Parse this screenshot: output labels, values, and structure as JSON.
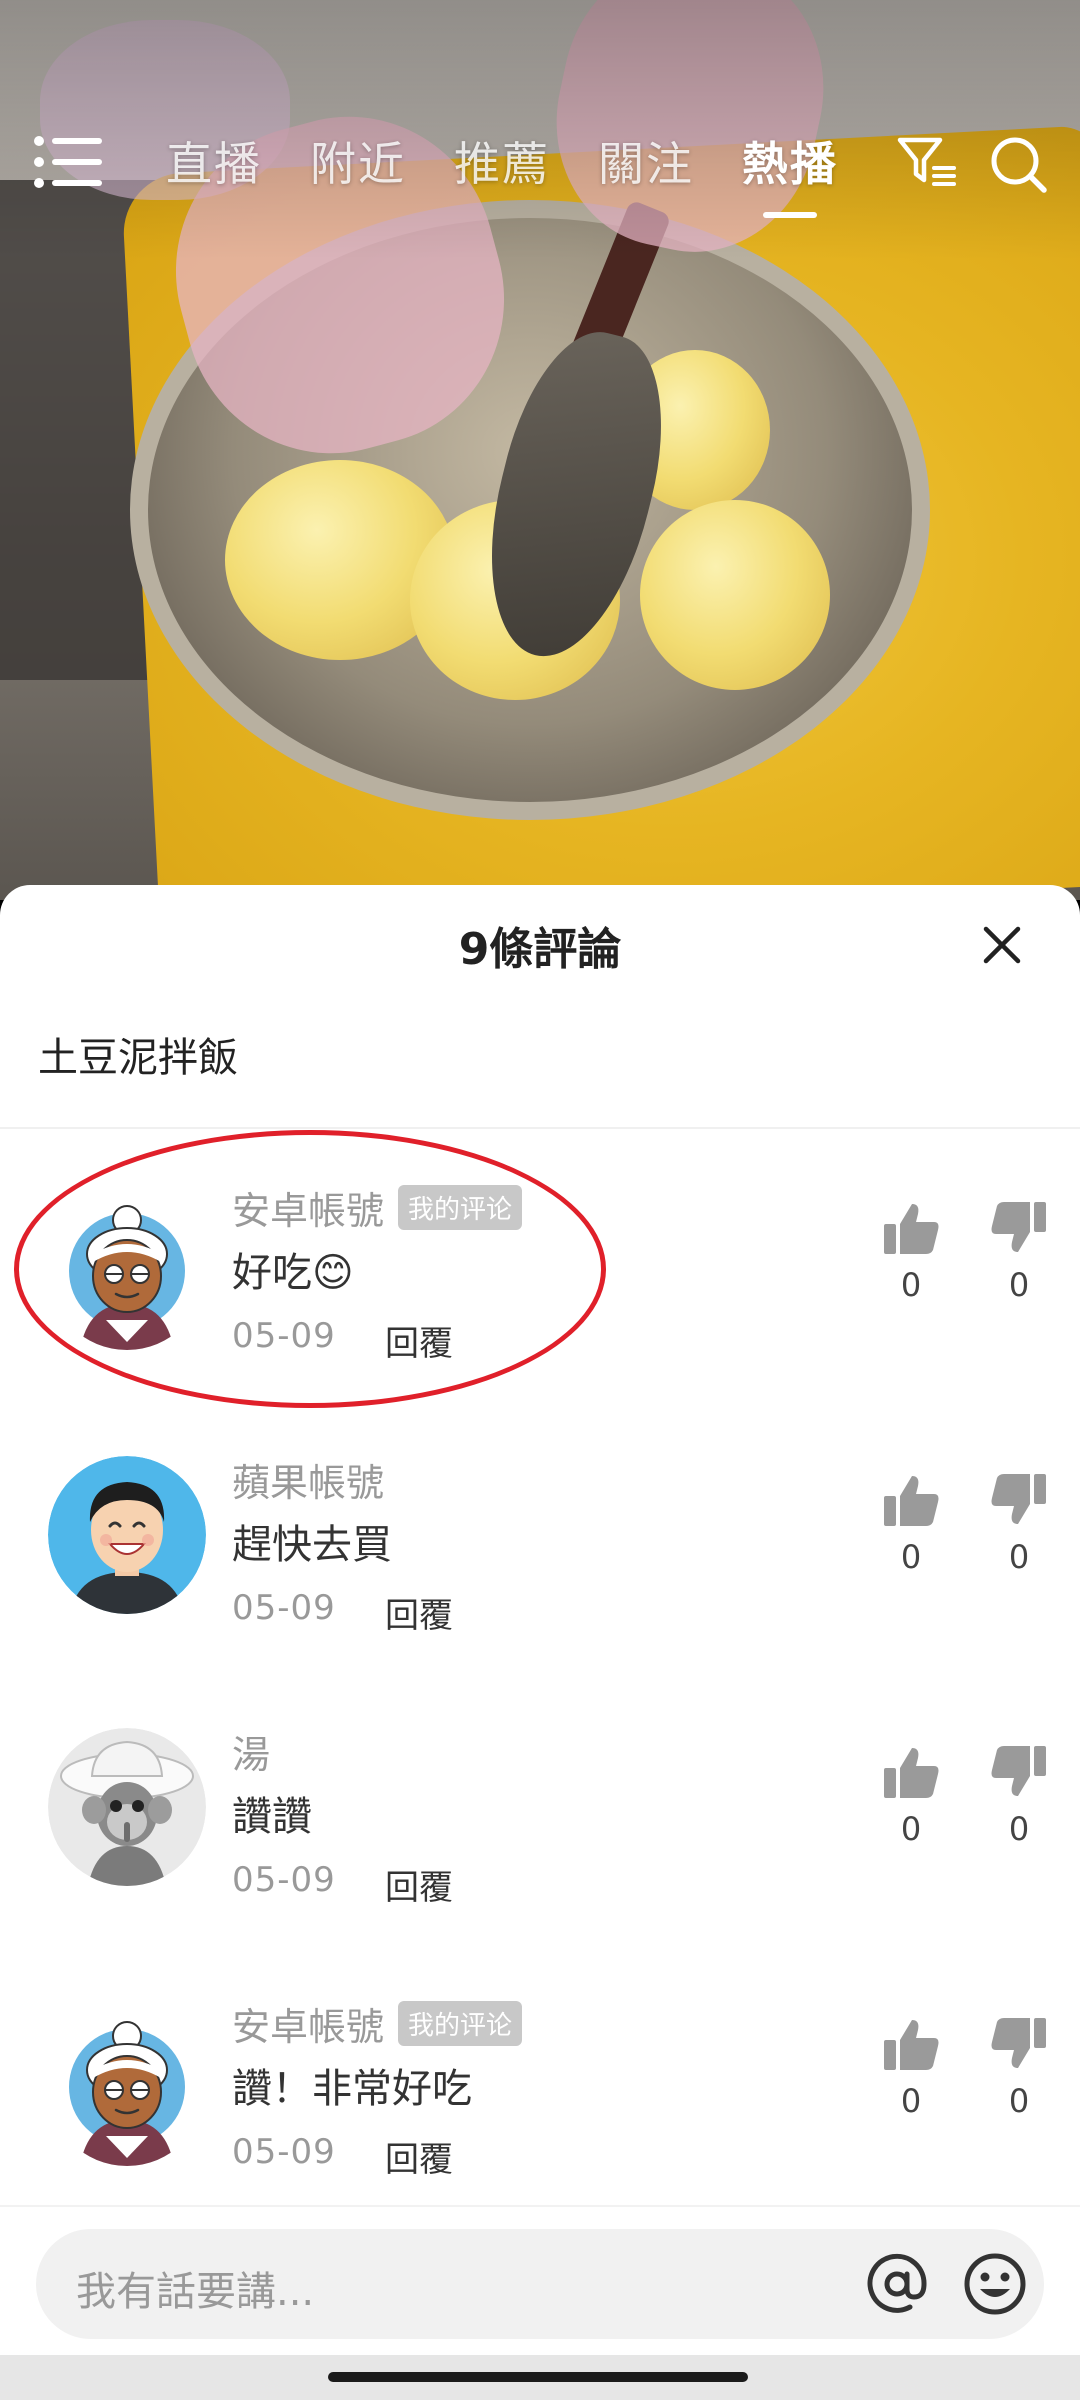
{
  "topnav": {
    "tabs": [
      {
        "label": "直播"
      },
      {
        "label": "附近"
      },
      {
        "label": "推薦"
      },
      {
        "label": "關注"
      },
      {
        "label": "熱播"
      }
    ],
    "active_tab": "熱播",
    "icons": [
      "menu-icon",
      "filter-icon",
      "search-icon"
    ]
  },
  "sheet": {
    "title": "9條評論",
    "caption": "土豆泥拌飯",
    "close_icon": "close-icon"
  },
  "comments": [
    {
      "author": "安卓帳號",
      "badge": "我的评论",
      "text": "好吃😊",
      "date": "05-09",
      "reply": "回覆",
      "likes": "0",
      "dislikes": "0",
      "avatar": "grandma-avatar"
    },
    {
      "author": "蘋果帳號",
      "badge": "",
      "text": "趕快去買",
      "date": "05-09",
      "reply": "回覆",
      "likes": "0",
      "dislikes": "0",
      "avatar": "smiling-man-avatar"
    },
    {
      "author": "湯",
      "badge": "",
      "text": "讚讚",
      "date": "05-09",
      "reply": "回覆",
      "likes": "0",
      "dislikes": "0",
      "avatar": "monkey-hat-avatar"
    },
    {
      "author": "安卓帳號",
      "badge": "我的评论",
      "text": "讚！非常好吃",
      "date": "05-09",
      "reply": "回覆",
      "likes": "0",
      "dislikes": "0",
      "avatar": "grandma-avatar"
    }
  ],
  "input": {
    "placeholder": "我有話要講...",
    "icons": [
      "at-icon",
      "emoji-icon"
    ]
  },
  "colors": {
    "highlight_ring": "#e0202a",
    "badge_bg": "#c8c8c8",
    "muted_text": "#999999"
  }
}
